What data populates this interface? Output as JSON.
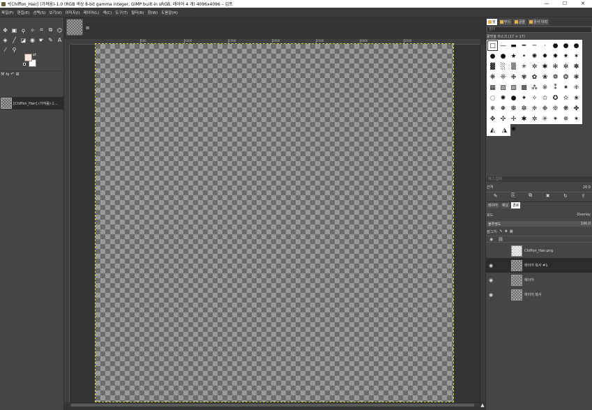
{
  "window": {
    "title": "*[Chiffon_Hair] (가져옴)-1.0 (RGB 색상 8-bit gamma integer, GIMP built-in sRGB, 레이어 4 개) 4096x4096 – 김프",
    "minimize": "—",
    "maximize": "☐",
    "close": "✕"
  },
  "menu": [
    "파일(F)",
    "편집(E)",
    "선택(S)",
    "보기(V)",
    "이미지(I)",
    "레이어(L)",
    "색(C)",
    "도구(T)",
    "필터(R)",
    "창(W)",
    "도움말(H)"
  ],
  "tools": [
    {
      "name": "move-tool-icon",
      "glyph": "✥"
    },
    {
      "name": "rect-select-icon",
      "glyph": "▣"
    },
    {
      "name": "lasso-icon",
      "glyph": "ϙ"
    },
    {
      "name": "fuzzy-select-icon",
      "glyph": "✧"
    },
    {
      "name": "crop-icon",
      "glyph": "⌗"
    },
    {
      "name": "unified-transform-icon",
      "glyph": "⧉"
    },
    {
      "name": "warp-icon",
      "glyph": "⌬"
    },
    {
      "name": "bucket-fill-icon",
      "glyph": "◈"
    },
    {
      "name": "paintbrush-icon",
      "glyph": "╱"
    },
    {
      "name": "eraser-icon",
      "glyph": "◪"
    },
    {
      "name": "clone-icon",
      "glyph": "◉"
    },
    {
      "name": "smudge-icon",
      "glyph": "☛"
    },
    {
      "name": "paths-icon",
      "glyph": "✎"
    },
    {
      "name": "text-icon",
      "glyph": "A"
    },
    {
      "name": "color-picker-icon",
      "glyph": "⁄"
    },
    {
      "name": "zoom-icon",
      "glyph": "⚲"
    }
  ],
  "toolbox_tabs": [
    "⚒",
    "⇆",
    "↶",
    "⊞"
  ],
  "images": [
    {
      "label": "[Chiffon_Hair] (가져옴)-1..."
    }
  ],
  "ruler_ticks": [
    "500",
    "1000",
    "1500",
    "2000",
    "2500",
    "3000",
    "3500"
  ],
  "dock": {
    "tabs": [
      {
        "label": "붓",
        "active": true
      },
      {
        "label": "무늬",
        "active": false
      },
      {
        "label": "글꼴",
        "active": false
      },
      {
        "label": "문서 이력",
        "active": false
      }
    ],
    "filter_placeholder": "필터",
    "brush_title": "물방울 마스크 (17 × 17)",
    "brushes": [
      "□",
      "—",
      "▬",
      "━",
      "─",
      "·",
      "●",
      "●",
      "●",
      "●",
      "●",
      "★",
      "•",
      "✺",
      "✹",
      "✸",
      "✷",
      "✶",
      "▓",
      "░",
      "▒",
      "✳",
      "✲",
      "✱",
      "✻",
      "✼",
      "✽",
      "❋",
      "❊",
      "❉",
      "✾",
      "✿",
      "❀",
      "❁",
      "❂",
      "❃",
      "▦",
      "▧",
      "▨",
      "▩",
      "⁂",
      "※",
      "⁑",
      "⁕",
      "⁜",
      "◌",
      "✺",
      "●",
      "✦",
      "✧",
      "✩",
      "✪",
      "✫",
      "✬",
      "❄",
      "❅",
      "❆",
      "❇",
      "❈",
      "❉",
      "❊",
      "❋",
      "✤",
      "✥",
      "✣",
      "✢",
      "✱",
      "✲",
      "✳",
      "✴",
      "✵",
      "✶",
      "✷",
      "✸",
      "✹"
    ],
    "brush_extra": [
      "◭",
      "◮"
    ],
    "tag_placeholder": "태그 입력",
    "spacing_label": "간격",
    "spacing_value": "20.0",
    "brush_actions": [
      "✎",
      "⎘",
      "⧉",
      "✖",
      "↻",
      "⇪"
    ],
    "layer_tabs": [
      {
        "label": "레이어",
        "active": false
      },
      {
        "label": "채널",
        "active": false
      },
      {
        "label": "경로",
        "active": true
      }
    ],
    "mode_label": "모드",
    "mode_value": "Overlay",
    "opacity_label": "불투명도",
    "opacity_value": "100.0",
    "lock_label": "잠그기:",
    "layers": [
      {
        "name": "Chiffon_Hair.png",
        "visible": false,
        "active": false,
        "thumb": "white"
      },
      {
        "name": "레이어 복사 #1",
        "visible": true,
        "active": true,
        "thumb": "checker"
      },
      {
        "name": "레이어",
        "visible": true,
        "active": false,
        "thumb": "checker"
      },
      {
        "name": "레이어 복사",
        "visible": true,
        "active": false,
        "thumb": "checker"
      }
    ]
  }
}
